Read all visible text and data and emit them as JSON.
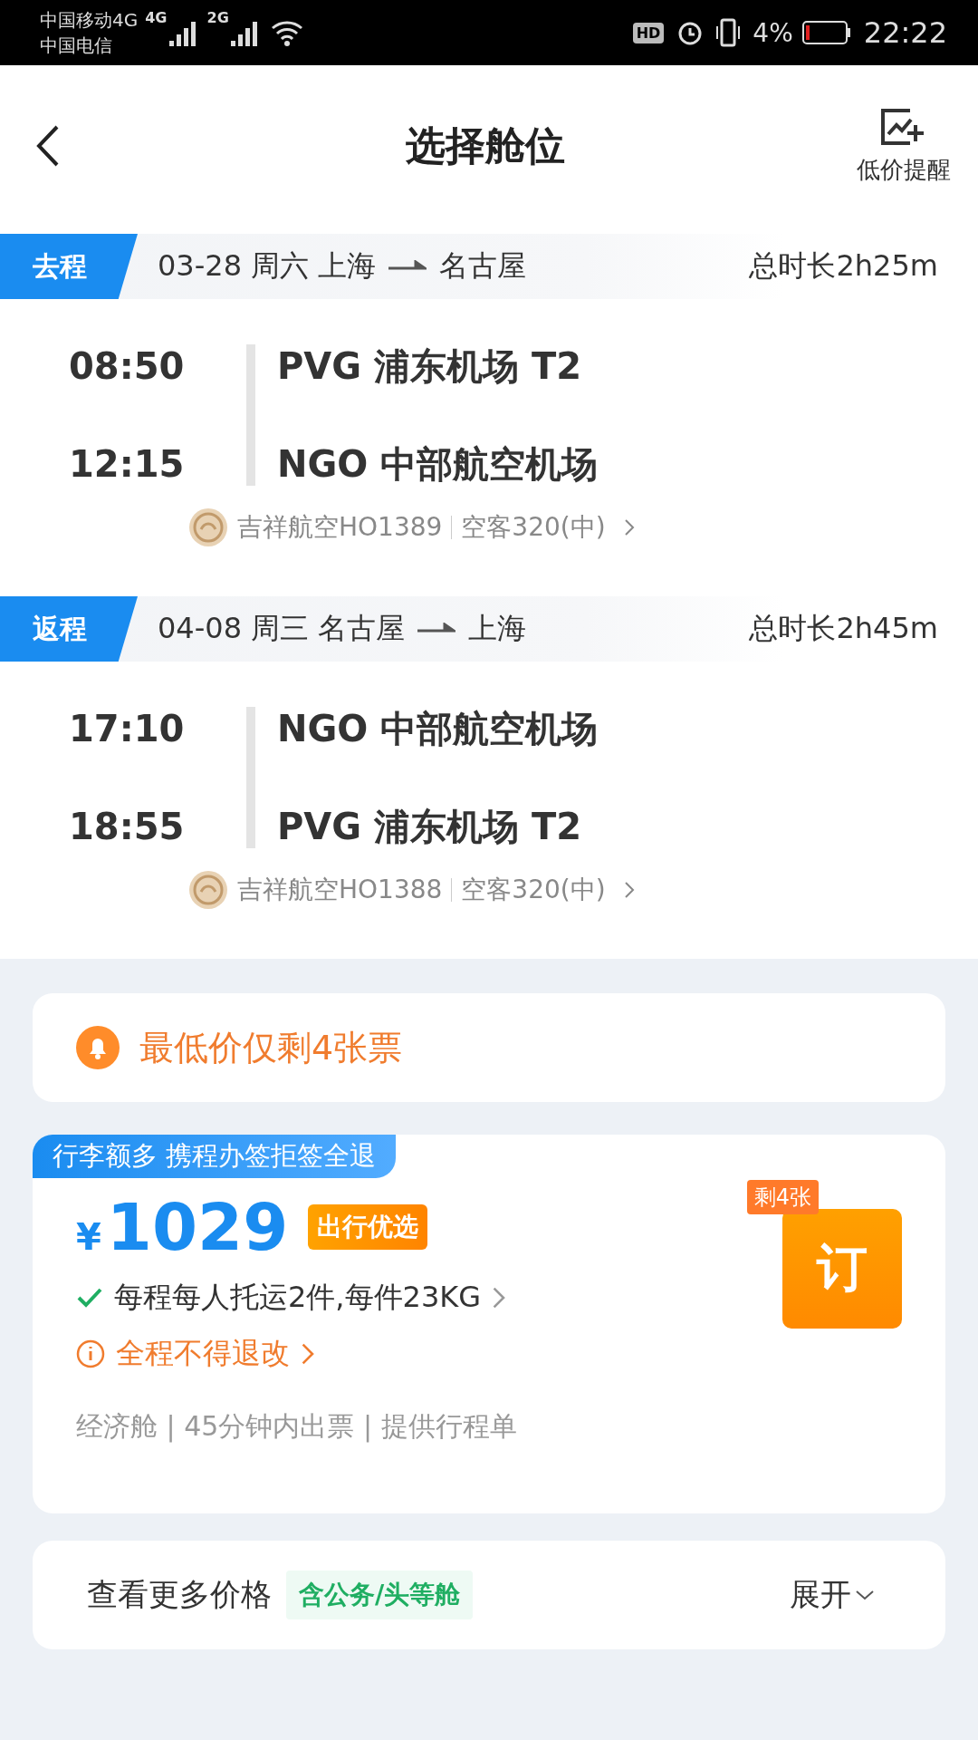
{
  "status_bar": {
    "carriers": [
      "中国移动4G",
      "中国电信"
    ],
    "networks": [
      "4G",
      "2G"
    ],
    "hd": "HD",
    "battery": "4%",
    "time": "22:22"
  },
  "header": {
    "title": "选择舱位",
    "alert_label": "低价提醒"
  },
  "legs": [
    {
      "tag": "去程",
      "from_text": "03-28 周六 上海",
      "to_text": "名古屋",
      "duration": "总时长2h25m",
      "depart": {
        "time": "08:50",
        "airport": "PVG 浦东机场 T2"
      },
      "arrive": {
        "time": "12:15",
        "airport": "NGO 中部航空机场"
      },
      "airline": "吉祥航空HO1389",
      "aircraft": "空客320(中)"
    },
    {
      "tag": "返程",
      "from_text": "04-08 周三 名古屋",
      "to_text": "上海",
      "duration": "总时长2h45m",
      "depart": {
        "time": "17:10",
        "airport": "NGO 中部航空机场"
      },
      "arrive": {
        "time": "18:55",
        "airport": "PVG 浦东机场 T2"
      },
      "airline": "吉祥航空HO1388",
      "aircraft": "空客320(中)"
    }
  ],
  "notice": "最低价仅剩4张票",
  "offer": {
    "banner": "行李额多 携程办签拒签全退",
    "currency": "¥",
    "price": "1029",
    "badge": "出行优选",
    "baggage": "每程每人托运2件,每件23KG",
    "rule": "全程不得退改",
    "info": "经济舱 | 45分钟内出票 | 提供行程单",
    "stock": "剩4张",
    "book": "订"
  },
  "more": {
    "label": "查看更多价格",
    "tag": "含公务/头等舱",
    "toggle": "展开"
  }
}
